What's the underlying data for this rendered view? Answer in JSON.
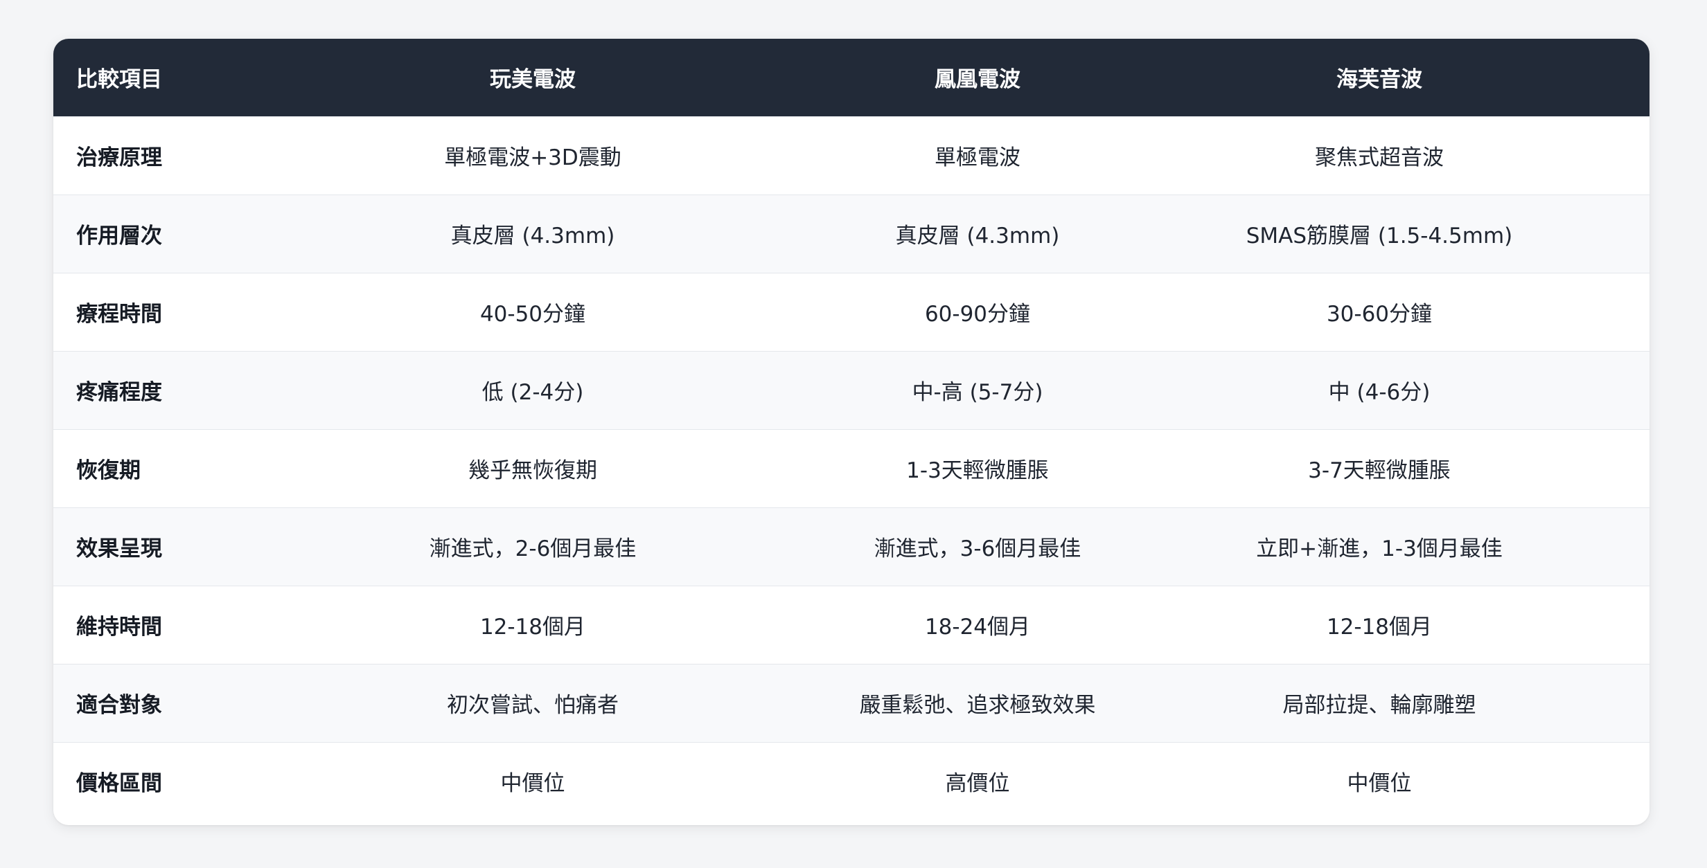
{
  "table": {
    "headers": [
      "比較項目",
      "玩美電波",
      "鳳凰電波",
      "海芙音波"
    ],
    "rows": [
      [
        "治療原理",
        "單極電波+3D震動",
        "單極電波",
        "聚焦式超音波"
      ],
      [
        "作用層次",
        "真皮層 (4.3mm)",
        "真皮層 (4.3mm)",
        "SMAS筋膜層 (1.5-4.5mm)"
      ],
      [
        "療程時間",
        "40-50分鐘",
        "60-90分鐘",
        "30-60分鐘"
      ],
      [
        "疼痛程度",
        "低 (2-4分)",
        "中-高 (5-7分)",
        "中 (4-6分)"
      ],
      [
        "恢復期",
        "幾乎無恢復期",
        "1-3天輕微腫脹",
        "3-7天輕微腫脹"
      ],
      [
        "效果呈現",
        "漸進式，2-6個月最佳",
        "漸進式，3-6個月最佳",
        "立即+漸進，1-3個月最佳"
      ],
      [
        "維持時間",
        "12-18個月",
        "18-24個月",
        "12-18個月"
      ],
      [
        "適合對象",
        "初次嘗試、怕痛者",
        "嚴重鬆弛、追求極致效果",
        "局部拉提、輪廓雕塑"
      ],
      [
        "價格區間",
        "中價位",
        "高價位",
        "中價位"
      ]
    ]
  },
  "colors": {
    "header_bg": "#222a38",
    "page_bg": "#f4f5f7",
    "row_alt_bg": "#f8f9fb"
  }
}
